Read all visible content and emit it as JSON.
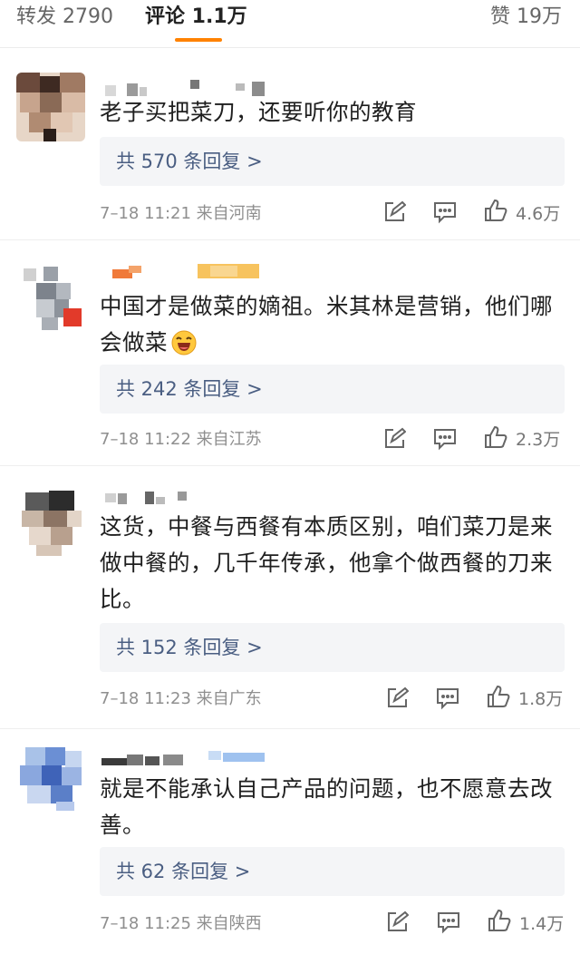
{
  "tabs": {
    "repost_label": "转发 2790",
    "comment_label": "评论 1.1万",
    "like_label": "赞 19万"
  },
  "colors": {
    "accent": "#ff8200",
    "reply_link": "#4a5e82",
    "reply_bg": "#f4f5f7",
    "meta_text": "#8f8f8f"
  },
  "comments": [
    {
      "text": "老子买把菜刀，还要听你的教育",
      "reply_label": "共 570 条回复 >",
      "meta": "7–18 11:21  来自河南",
      "likes": "4.6万"
    },
    {
      "text": "中国才是做菜的嫡祖。米其林是营销，他们哪会做菜",
      "emoji_icon": "laughing-emoji-icon",
      "reply_label": "共 242 条回复 >",
      "meta": "7–18 11:22  来自江苏",
      "likes": "2.3万"
    },
    {
      "text": "这货，中餐与西餐有本质区别，咱们菜刀是来做中餐的，几千年传承，他拿个做西餐的刀来比。",
      "reply_label": "共 152 条回复 >",
      "meta": "7–18 11:23  来自广东",
      "likes": "1.8万"
    },
    {
      "text": "就是不能承认自己产品的问题，也不愿意去改善。",
      "reply_label": "共 62 条回复 >",
      "meta": "7–18 11:25  来自陕西",
      "likes": "1.4万"
    }
  ],
  "icons": {
    "forward": "share-edit-icon",
    "comment": "comment-bubble-icon",
    "like": "thumbs-up-icon"
  }
}
